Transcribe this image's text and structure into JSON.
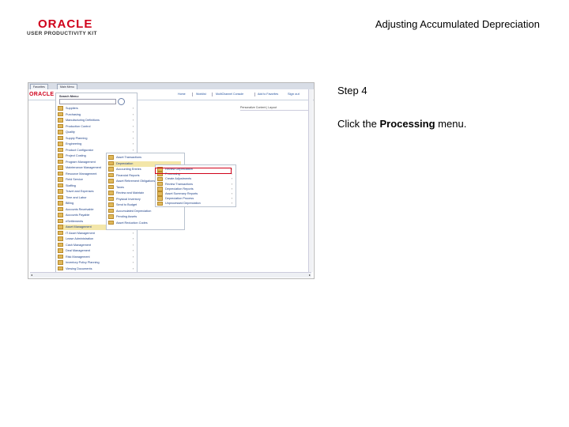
{
  "header": {
    "logo_oracle": "ORACLE",
    "logo_upk": "USER PRODUCTIVITY KIT",
    "doc_title": "Adjusting Accumulated Depreciation"
  },
  "step": {
    "title": "Step 4",
    "instruction_prefix": "Click the ",
    "instruction_target": "Processing",
    "instruction_suffix": " menu."
  },
  "shot": {
    "tabs": [
      "Favorites",
      "Main Menu"
    ],
    "mini_logo": "ORACLE",
    "nav_links": [
      "Home",
      "Worklist",
      "MultiChannel Console",
      "Add to Favorites",
      "Sign out"
    ],
    "personalize": "Personalize Content | Layout",
    "search_label": "Search Menu:",
    "menu_items": [
      "Suppliers",
      "Purchasing",
      "Manufacturing Definitions",
      "Production Control",
      "Quality",
      "Supply Planning",
      "Engineering",
      "Product Configurator",
      "Project Costing",
      "Program Management",
      "Maintenance Management",
      "Resource Management",
      "Field Service",
      "Staffing",
      "Travel and Expenses",
      "Time and Labor",
      "Billing",
      "Accounts Receivable",
      "Accounts Payable",
      "eSettlements",
      "Asset Management",
      "IT Asset Management",
      "Lease Administration",
      "Cash Management",
      "Deal Management",
      "Risk Management",
      "Inventory Policy Planning",
      "Viewing Documents",
      "Data Governance"
    ],
    "submenu_items": [
      "Asset Transactions",
      "Depreciation",
      "Accounting Entries",
      "Financial Reports",
      "Asset Retirement Obligations",
      "Taxes",
      "Review and Maintain",
      "Physical Inventory",
      "Send to Budget",
      "Accumulated Depreciation",
      "Pending Assets",
      "Asset Reduction Codes"
    ],
    "submenu2_items": [
      "Review Depreciation",
      "Processing",
      "Create Adjustments",
      "Review Transactions",
      "Depreciation Reports",
      "Asset Summary Reports",
      "Depreciation Process",
      "Unprocessed Depreciation"
    ]
  }
}
